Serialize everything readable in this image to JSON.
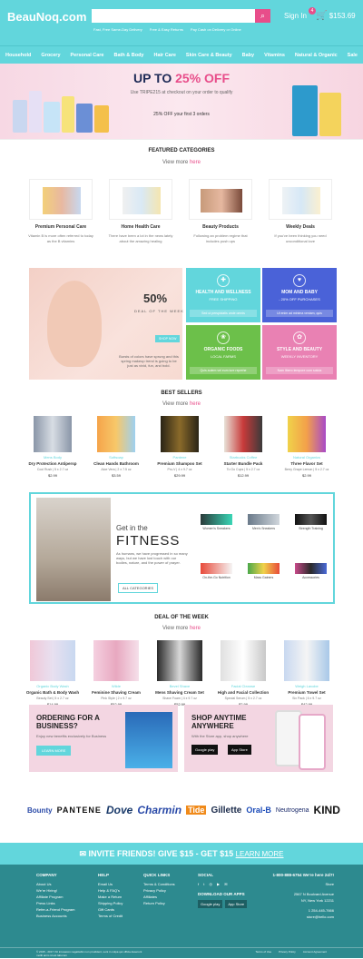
{
  "header": {
    "logo": "BeauNoq.com",
    "search_placeholder": "",
    "sign_in": "Sign In",
    "cart_total": "$153.69",
    "cart_count": "4",
    "perks": [
      "Fast, Free Same-Day Delivery",
      "Free & Easy Returns",
      "Pay Cash on Delivery or Online"
    ]
  },
  "nav": [
    "Household",
    "Grocery",
    "Personal Care",
    "Bath & Body",
    "Hair Care",
    "Skin Care & Beauty",
    "Baby",
    "Vitamins",
    "Natural & Organic",
    "Sale"
  ],
  "hero": {
    "title_pre": "UP TO ",
    "title_pct": "25% OFF",
    "subtitle": "Use TRIPE215 at checkout on your order to qualify",
    "subtitle2": "25% OFF your first 3 orders"
  },
  "featured": {
    "title": "FEATURED CATEGORIES",
    "view_more": "View more",
    "here": "here",
    "items": [
      {
        "title": "Premium Personal Care",
        "desc": "Vitamin B is more often referred to today as the B vitamins"
      },
      {
        "title": "Home Health Care",
        "desc": "There have been a lot in the news lately about the amazing healing"
      },
      {
        "title": "Beauty Products",
        "desc": "Following an problem regime that includes push ups"
      },
      {
        "title": "Weekly Deals",
        "desc": "If you've been thinking you need unconditional love"
      }
    ]
  },
  "promo": {
    "percent": "50%",
    "deal_label": "DEAL OF THE WEEK",
    "shop_now": "SHOP NOW",
    "text": "Bursts of colors have sprung and this spring makeup trend is going to be just as vivid, fun, and bold.",
    "tiles": [
      {
        "title": "HEALTH AND WELLNESS",
        "sub": "FREE SHIPPING",
        "bar": "Sed ut perspiciatis unde omnis",
        "color": "#62d6dc",
        "icon": "✚"
      },
      {
        "title": "MOM AND BABY",
        "sub": "- 20% OFF PURCHASES",
        "bar": "Ut enim ad minima veniam, quis",
        "color": "#4a62d8",
        "icon": "♥"
      },
      {
        "title": "ORGANIC FOODS",
        "sub": "LOCAL FARMS",
        "bar": "Quis autem vel eum iure reprehe",
        "color": "#6cc04a",
        "icon": "❀"
      },
      {
        "title": "STYLE AND BEAUTY",
        "sub": "WEEKLY INVENTORY",
        "bar": "Nam libero tempore cum soluta",
        "color": "#e981b3",
        "icon": "✿"
      }
    ]
  },
  "best_sellers": {
    "title": "BEST SELLERS",
    "view_more": "View more",
    "here": "here",
    "items": [
      {
        "cat": "Mens Body",
        "name": "Dry Protection Antipersp",
        "meta": "Cool Rush | 5 x 2.7 oz",
        "price": "$2.99"
      },
      {
        "cat": "Softsoap",
        "name": "Clean Hands Bathroom",
        "meta": "Aloe Vera | 2 x 7.5 oz",
        "price": "$3.59"
      },
      {
        "cat": "Pantene",
        "name": "Premium Shampoo Set",
        "meta": "Pro-V | 4 x 9.7 oz",
        "price": "$29.99"
      },
      {
        "cat": "Starbucks Coffee",
        "name": "Starter Bundle Pack",
        "meta": "To Go Cups | 5 x 2.7 oz",
        "price": "$12.99"
      },
      {
        "cat": "Natural Organics",
        "name": "Three Flavor Set",
        "meta": "Berry Grape Lemon | 5 x 2.7 oz",
        "price": "$2.99"
      }
    ]
  },
  "fitness": {
    "small": "Get in the",
    "big": "FITNESS",
    "text": "As humans, we have progressed in so many ways, but we have lost touch with our bodies, nature, and the power of prayer.",
    "button": "ALL CATEGORIES",
    "cells": [
      "Women's Sneakers",
      "Men's Sneakers",
      "Strength Training",
      "On-the-Go Nutrition",
      "Mass Gainers",
      "Accessories"
    ]
  },
  "deal_week": {
    "title": "DEAL OF THE WEEK",
    "view_more": "View more",
    "here": "here",
    "items": [
      {
        "cat": "Organic Body Wash",
        "name": "Organic Bath & Body Wash",
        "meta": "Beauty Set | 5 x 2.7 oz",
        "price": "$14.99"
      },
      {
        "cat": "Wilde",
        "name": "Feminine Shaving Cream",
        "meta": "Pink Style | 2 x 9.7 oz",
        "price": "$52.99"
      },
      {
        "cat": "Bevel Shave",
        "name": "Mens Shaving Cream Set",
        "meta": "Shave Foam | 4 x 9.7 oz",
        "price": "$52.99"
      },
      {
        "cat": "Facial Cleanse",
        "name": "High and Facial Collection",
        "meta": "Special Serum | 5 x 2.7 oz",
        "price": "$2.99"
      },
      {
        "cat": "Weigh Lavobe",
        "name": "Premium Towel Set",
        "meta": "Six Pack | 6 x 9.7 oz",
        "price": "$42.99"
      }
    ]
  },
  "business": {
    "title": "ORDERING FOR A BUSINESS?",
    "sub": "Enjoy new benefits exclusively for Business",
    "button": "LEARN MORE"
  },
  "app": {
    "title": "SHOP ANYTIME ANYWHERE",
    "sub": "With the Store app, shop anywhere",
    "google": "Google play",
    "apple": "App Store"
  },
  "brands": [
    "Bounty",
    "PANTENE",
    "Dove",
    "Charmin",
    "Tide",
    "Gillette",
    "Oral-B",
    "Neutrogena",
    "KIND"
  ],
  "invite": {
    "text": "INVITE FRIENDS! GIVE $15 - GET $15",
    "link": "LEARN MORE"
  },
  "footer": {
    "company": {
      "h": "COMPANY",
      "items": [
        "About Us",
        "We're Hiring!",
        "Affiliate Program",
        "Press Links",
        "Refer-a-Friend Program",
        "Business Accounts"
      ]
    },
    "help": {
      "h": "HELP",
      "items": [
        "Email Us",
        "Help & FAQ's",
        "Make a Return",
        "Shipping Policy",
        "Gift Cards",
        "Terms of Credit"
      ]
    },
    "quick": {
      "h": "QUICK LINKS",
      "items": [
        "Terms & Conditions",
        "Privacy Policy",
        "Affiliates",
        "Return Policy"
      ]
    },
    "social": {
      "h": "SOCIAL",
      "download": "DOWNLOAD OUR APPS"
    },
    "contact": {
      "phone": "1-800-888-6754 We're here 24/7!",
      "store": "Store",
      "addr1": "2567 N Boulvard Avenue",
      "addr2": "NY, New York 12211",
      "phone2": "1 254-445-7666",
      "email": "store@hello.com"
    },
    "copyright": "© 2015 - 2017 Viz inrosacon nagattabin non proiddent, sunt in culpa qui officia deserunt mollit anim id est laborum",
    "legal": [
      "Terms of Use",
      "Privacy Policy",
      "Account Agreement"
    ]
  },
  "colors": {
    "accent": "#62d6dc",
    "pink": "#e84d8a",
    "footer": "#2d8a8f"
  }
}
